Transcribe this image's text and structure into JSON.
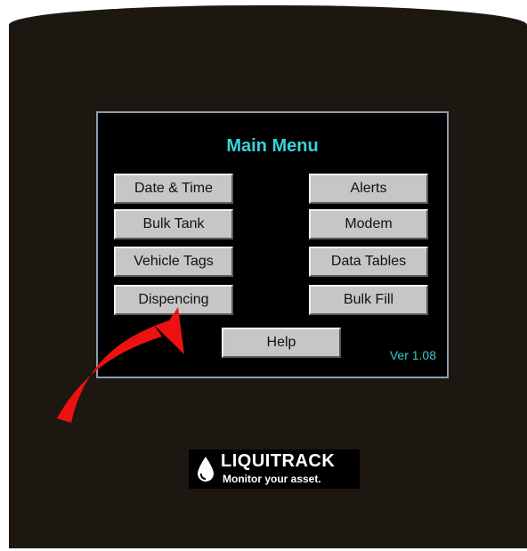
{
  "menu": {
    "title": "Main Menu",
    "buttons": {
      "date_time": "Date & Time",
      "bulk_tank": "Bulk Tank",
      "vehicle_tags": "Vehicle Tags",
      "dispencing": "Dispencing",
      "alerts": "Alerts",
      "modem": "Modem",
      "data_tables": "Data Tables",
      "bulk_fill": "Bulk Fill",
      "help": "Help"
    },
    "version": "Ver 1.08"
  },
  "logo": {
    "name": "LIQUITRACK",
    "tagline": "Monitor your asset."
  },
  "colors": {
    "title": "#3ad3d8",
    "button_face": "#c6c6c6",
    "arrow": "#ee1111",
    "bezel": "#1c1710"
  }
}
